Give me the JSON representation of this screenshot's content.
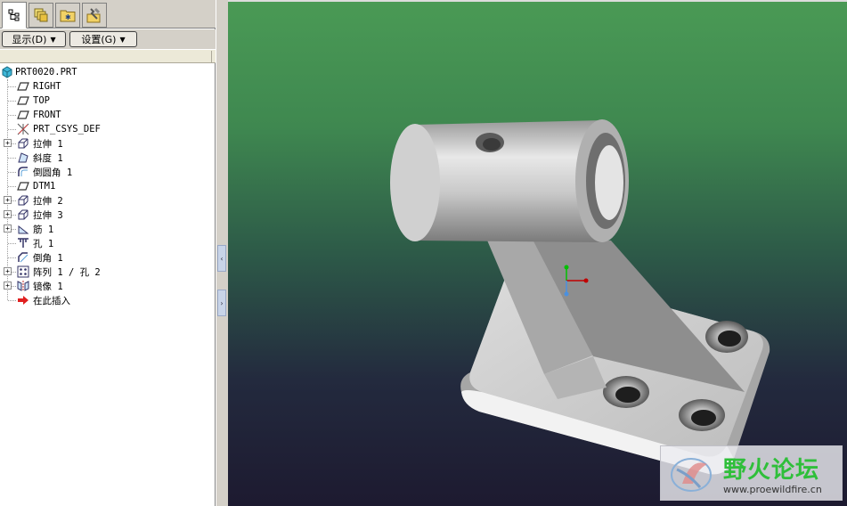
{
  "tabs": [
    {
      "name": "model-tree-tab",
      "icon": "tree-icon"
    },
    {
      "name": "layers-tab",
      "icon": "layers-icon"
    },
    {
      "name": "folder-browser-tab",
      "icon": "folder-icon"
    },
    {
      "name": "favorites-tab",
      "icon": "tools-icon"
    }
  ],
  "toolbar": {
    "show_label": "显示(D)",
    "settings_label": "设置(G)"
  },
  "tree": {
    "root": "PRT0020.PRT",
    "items": [
      {
        "label": "RIGHT",
        "icon": "datum-plane-icon",
        "expandable": false
      },
      {
        "label": "TOP",
        "icon": "datum-plane-icon",
        "expandable": false
      },
      {
        "label": "FRONT",
        "icon": "datum-plane-icon",
        "expandable": false
      },
      {
        "label": "PRT_CSYS_DEF",
        "icon": "csys-icon",
        "expandable": false
      },
      {
        "label": "拉伸 1",
        "icon": "extrude-icon",
        "expandable": true
      },
      {
        "label": "斜度 1",
        "icon": "draft-icon",
        "expandable": false
      },
      {
        "label": "倒圆角 1",
        "icon": "round-icon",
        "expandable": false
      },
      {
        "label": "DTM1",
        "icon": "datum-plane-icon",
        "expandable": false
      },
      {
        "label": "拉伸 2",
        "icon": "extrude-icon",
        "expandable": true
      },
      {
        "label": "拉伸 3",
        "icon": "extrude-icon",
        "expandable": true
      },
      {
        "label": "筋 1",
        "icon": "rib-icon",
        "expandable": true
      },
      {
        "label": "孔 1",
        "icon": "hole-icon",
        "expandable": false
      },
      {
        "label": "倒角 1",
        "icon": "chamfer-icon",
        "expandable": false
      },
      {
        "label": "阵列 1 / 孔 2",
        "icon": "pattern-icon",
        "expandable": true
      },
      {
        "label": "镜像 1",
        "icon": "mirror-icon",
        "expandable": true
      },
      {
        "label": "在此插入",
        "icon": "insert-here-icon",
        "expandable": false
      }
    ]
  },
  "watermark": {
    "title": "野火论坛",
    "url": "www.proewildfire.cn"
  },
  "colors": {
    "viewport_top": "#4a9a55",
    "viewport_bottom": "#1d1a30",
    "model_gray": "#c8c8c8",
    "watermark_green": "#2fbf3a"
  }
}
